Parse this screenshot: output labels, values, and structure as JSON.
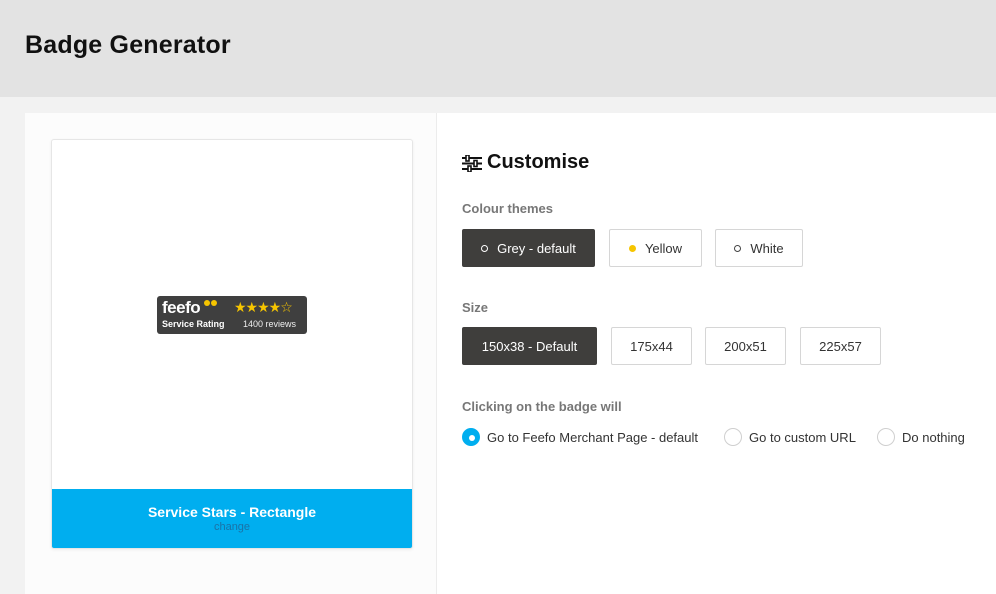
{
  "header": {
    "title": "Badge Generator"
  },
  "preview": {
    "badge": {
      "logo_text": "feefo",
      "label": "Service Rating",
      "stars": "★★★★",
      "half_star": "☆",
      "reviews": "1400 reviews"
    },
    "card_title": "Service Stars - Rectangle",
    "change_link": "change"
  },
  "customise": {
    "title": "Customise",
    "colour_themes": {
      "label": "Colour themes",
      "options": [
        "Grey - default",
        "Yellow",
        "White"
      ],
      "selected": "Grey - default"
    },
    "size": {
      "label": "Size",
      "options": [
        "150x38 - Default",
        "175x44",
        "200x51",
        "225x57"
      ],
      "selected": "150x38 - Default"
    },
    "click_action": {
      "label": "Clicking on the badge will",
      "options": [
        "Go to Feefo Merchant Page - default",
        "Go to custom URL",
        "Do nothing"
      ],
      "selected": "Go to Feefo Merchant Page - default"
    }
  },
  "colors": {
    "accent_blue": "#00aeef",
    "selected_dark": "#3f3e3c",
    "star_yellow": "#f6c500"
  }
}
